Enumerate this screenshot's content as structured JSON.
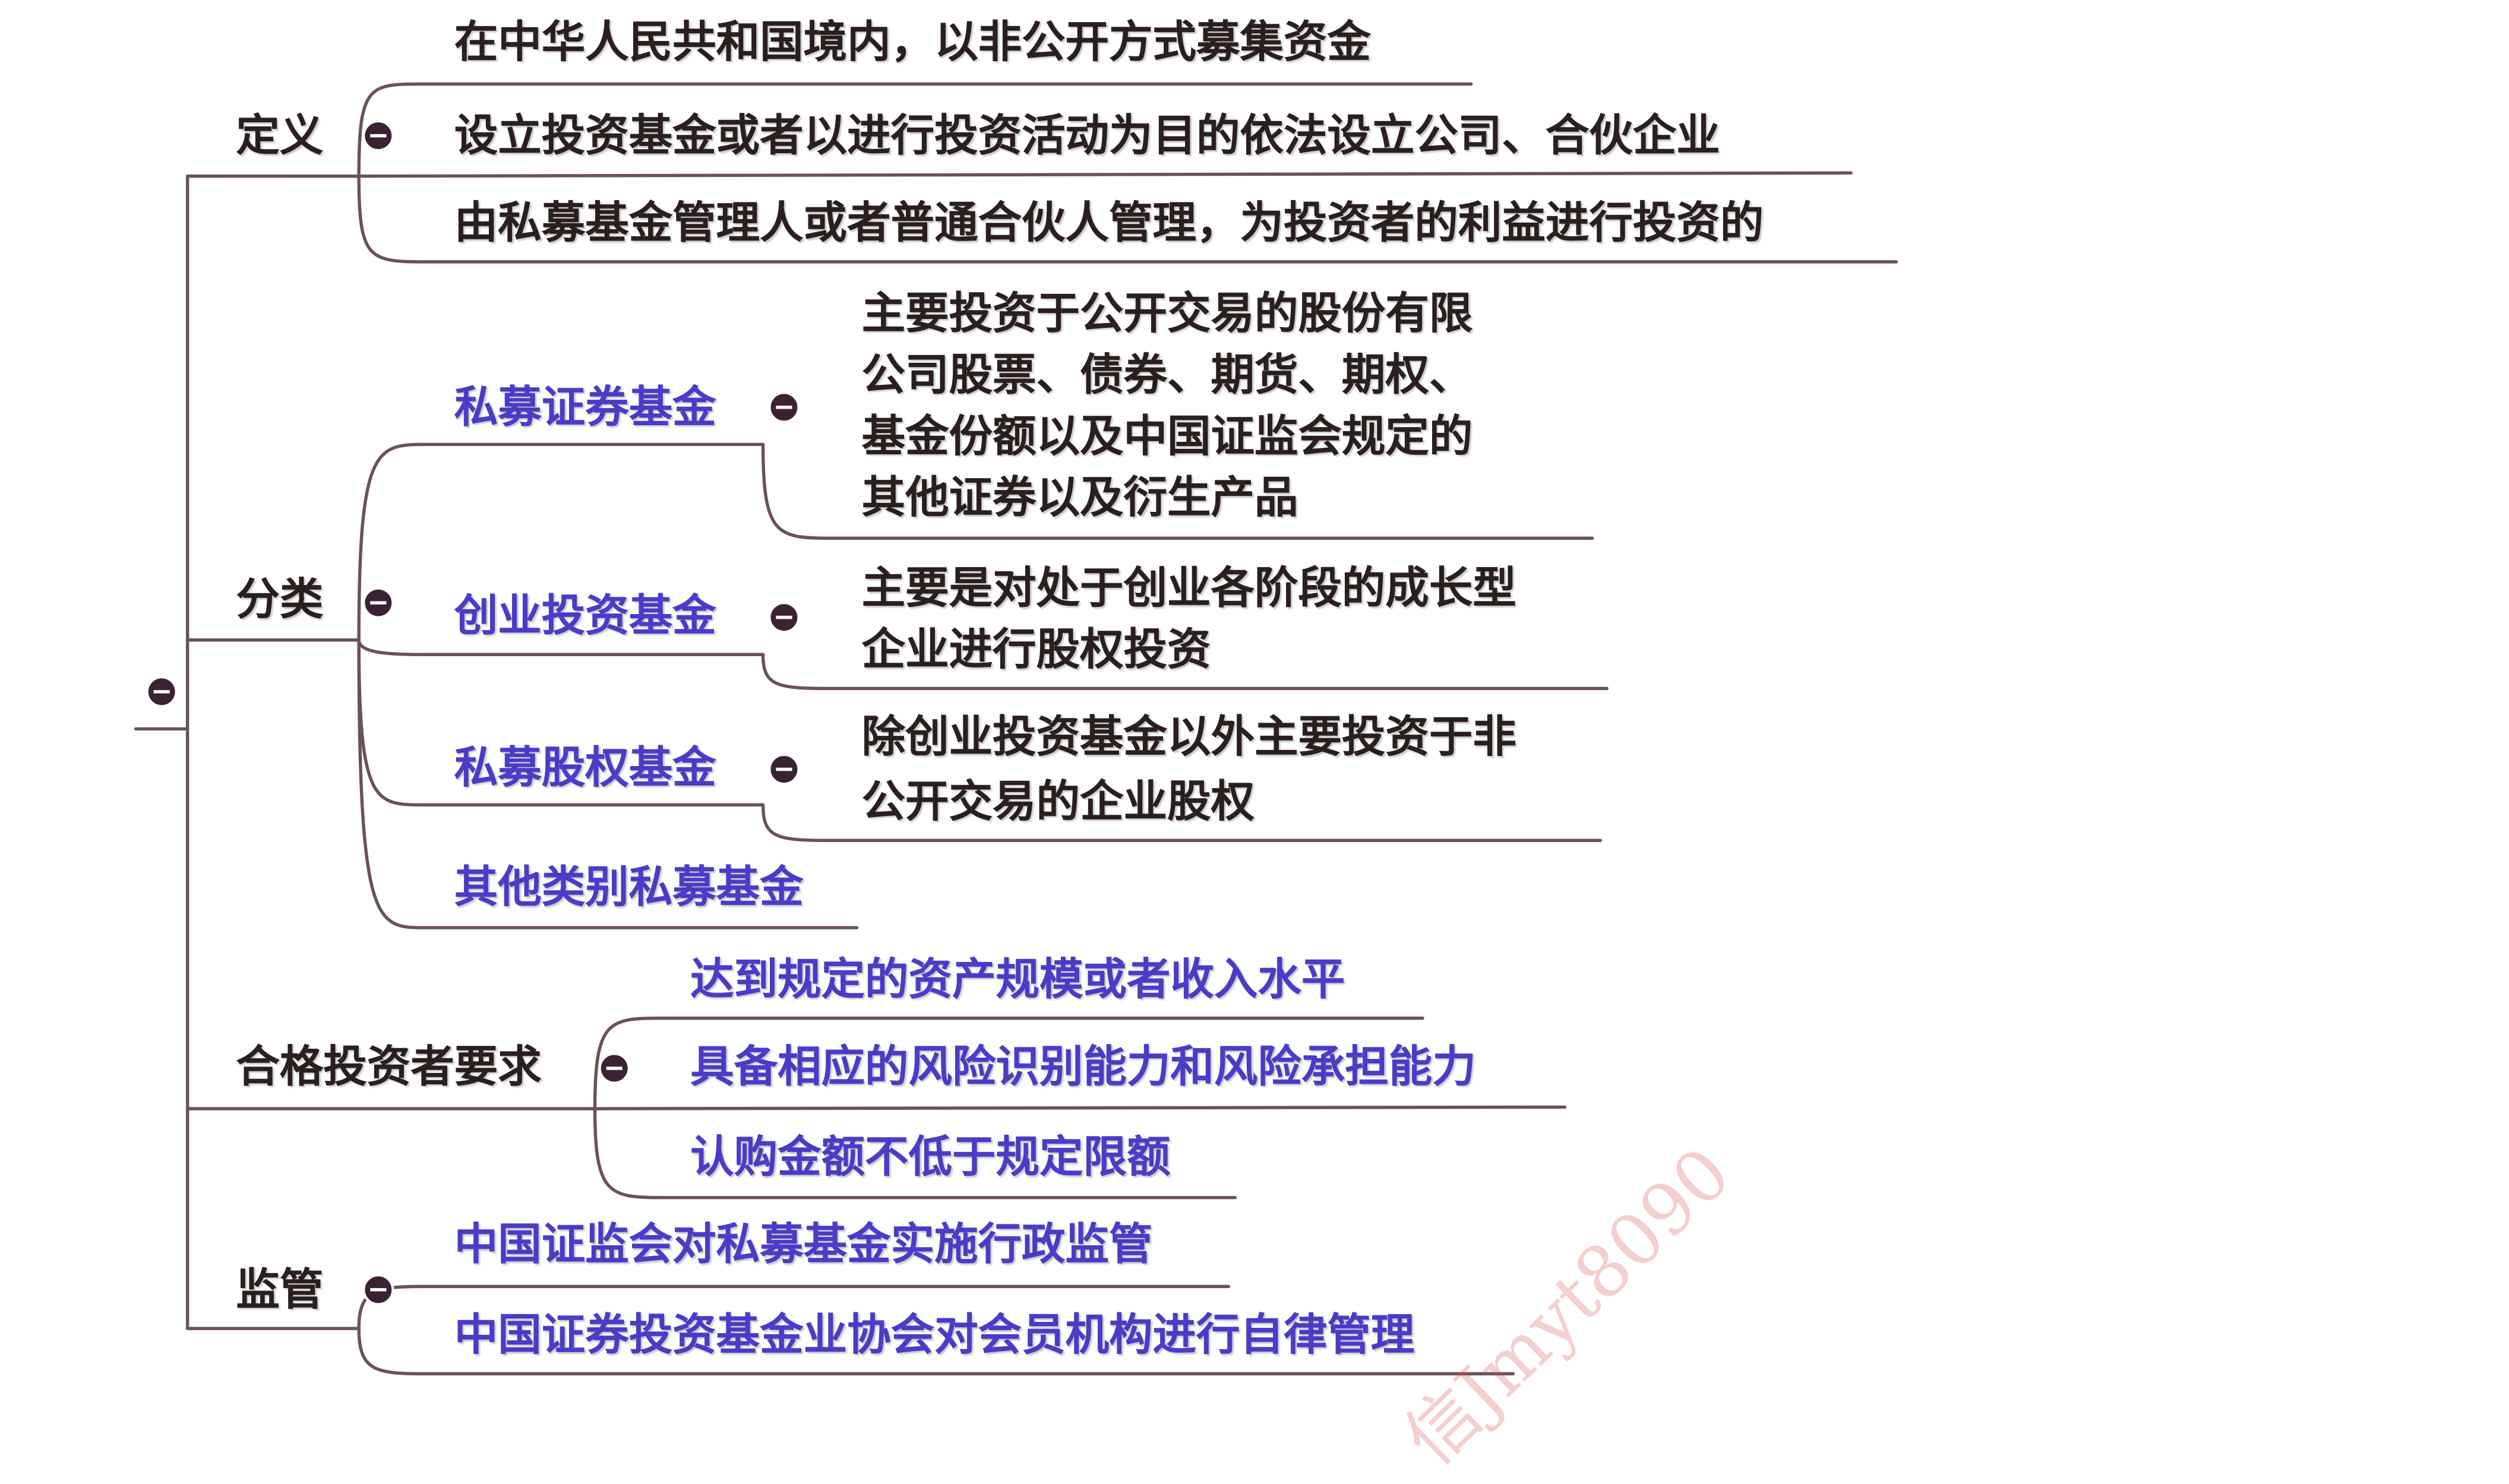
{
  "colors": {
    "line": "#6a5258",
    "dark_text": "#2a1e1e",
    "blue_text": "#4a3bc8",
    "toggle_fill": "#3a2233",
    "watermark": "#dc5050"
  },
  "icons": {
    "collapse": "minus-circle-icon"
  },
  "root": {
    "collapsed_toggle": "⊖"
  },
  "definition": {
    "label": "定义",
    "items": [
      "在中华人民共和国境内，以非公开方式募集资金",
      "设立投资基金或者以进行投资活动为目的依法设立公司、合伙企业",
      "由私募基金管理人或者普通合伙人管理，为投资者的利益进行投资的"
    ]
  },
  "classification": {
    "label": "分类",
    "securities": {
      "label": "私募证券基金",
      "desc": [
        "主要投资于公开交易的股份有限",
        "公司股票、债券、期货、期权、",
        "基金份额以及中国证监会规定的",
        "其他证券以及衍生产品"
      ]
    },
    "venture": {
      "label": "创业投资基金",
      "desc": [
        "主要是对处于创业各阶段的成长型",
        "企业进行股权投资"
      ]
    },
    "equity": {
      "label": "私募股权基金",
      "desc": [
        "除创业投资基金以外主要投资于非",
        "公开交易的企业股权"
      ]
    },
    "other": {
      "label": "其他类别私募基金"
    }
  },
  "qualified": {
    "label": "合格投资者要求",
    "items": [
      "达到规定的资产规模或者收入水平",
      "具备相应的风险识别能力和风险承担能力",
      "认购金额不低于规定限额"
    ]
  },
  "supervision": {
    "label": "监管",
    "items": [
      "中国证监会对私募基金实施行政监管",
      "中国证券投资基金业协会对会员机构进行自律管理"
    ]
  },
  "watermark": {
    "text": "信Jmyt8090"
  }
}
